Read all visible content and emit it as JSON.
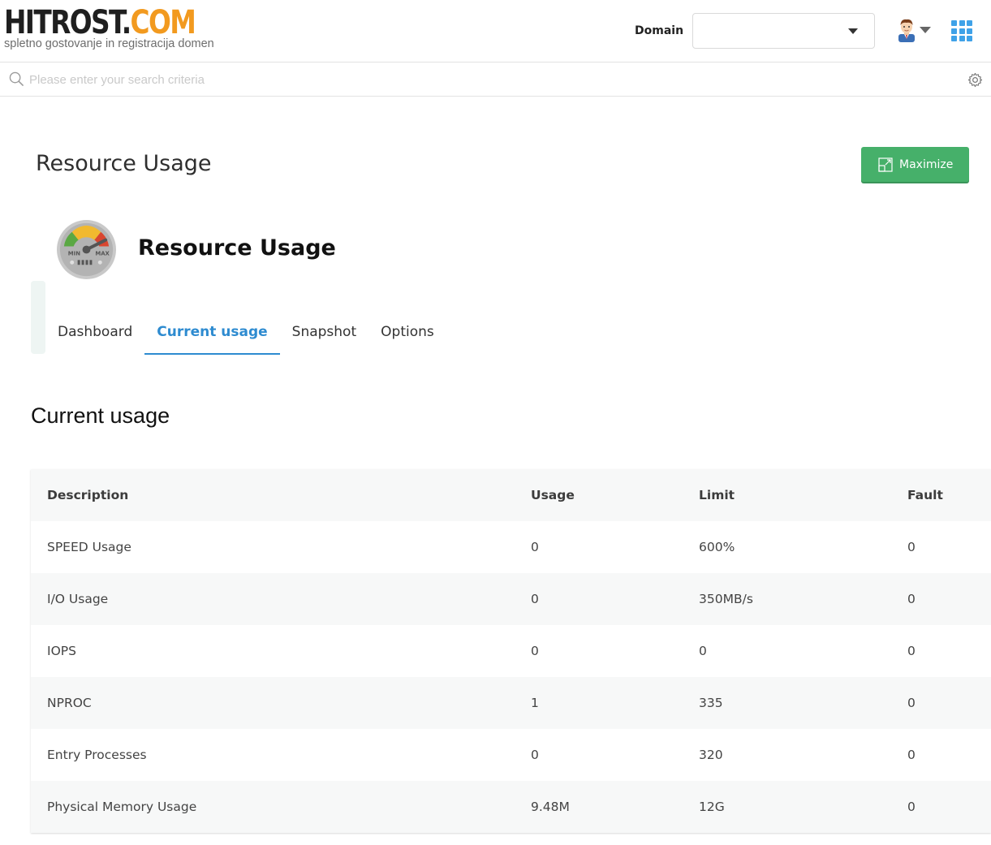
{
  "header": {
    "logo_part1": "HITROST.",
    "logo_part2": "COM",
    "logo_tagline": "spletno gostovanje in registracija domen",
    "domain_label": "Domain",
    "domain_value": ""
  },
  "search": {
    "placeholder": "Please enter your search criteria"
  },
  "page": {
    "title": "Resource Usage",
    "maximize_label": "Maximize"
  },
  "plugin": {
    "title": "Resource Usage",
    "gauge_min": "MIN",
    "gauge_max": "MAX"
  },
  "tabs": [
    {
      "label": "Dashboard",
      "active": false
    },
    {
      "label": "Current usage",
      "active": true
    },
    {
      "label": "Snapshot",
      "active": false
    },
    {
      "label": "Options",
      "active": false
    }
  ],
  "section": {
    "title": "Current usage"
  },
  "table": {
    "columns": [
      "Description",
      "Usage",
      "Limit",
      "Fault"
    ],
    "rows": [
      [
        "SPEED Usage",
        "0",
        "600%",
        "0"
      ],
      [
        "I/O Usage",
        "0",
        "350MB/s",
        "0"
      ],
      [
        "IOPS",
        "0",
        "0",
        "0"
      ],
      [
        "NPROC",
        "1",
        "335",
        "0"
      ],
      [
        "Entry Processes",
        "0",
        "320",
        "0"
      ],
      [
        "Physical Memory Usage",
        "9.48M",
        "12G",
        "0"
      ]
    ]
  },
  "colors": {
    "accent": "#2e8bd0",
    "maximize_bg": "#46b06a",
    "logo_orange": "#f29a1f",
    "apps_icon": "#3fa2e8"
  },
  "icons": {
    "search": "search-icon",
    "settings": "gear-icon",
    "apps": "grid-icon",
    "avatar": "user-avatar-icon",
    "maximize": "maximize-icon",
    "plugin": "gauge-icon"
  }
}
